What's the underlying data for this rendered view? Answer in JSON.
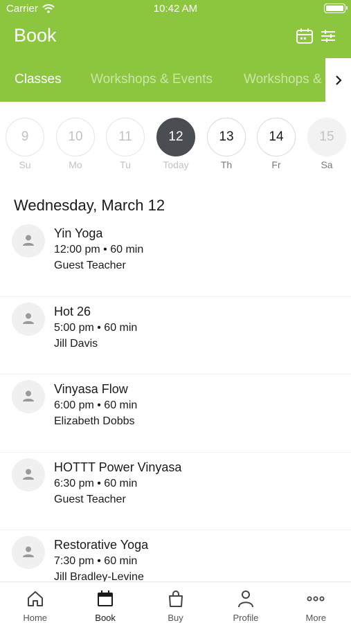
{
  "status_bar": {
    "carrier": "Carrier",
    "time": "10:42 AM"
  },
  "header": {
    "title": "Book",
    "background": "#8cc63f"
  },
  "tabs": [
    {
      "label": "Classes",
      "active": true
    },
    {
      "label": "Workshops & Events",
      "active": false
    },
    {
      "label": "Workshops &",
      "active": false
    }
  ],
  "days": [
    {
      "number": "9",
      "label": "Su"
    },
    {
      "number": "10",
      "label": "Mo"
    },
    {
      "number": "11",
      "label": "Tu"
    },
    {
      "number": "12",
      "label": "Today"
    },
    {
      "number": "13",
      "label": "Th"
    },
    {
      "number": "14",
      "label": "Fr"
    },
    {
      "number": "15",
      "label": "Sa"
    }
  ],
  "date_heading": "Wednesday, March 12",
  "classes": [
    {
      "name": "Yin Yoga",
      "time": "12:00 pm • 60 min",
      "teacher": "Guest Teacher"
    },
    {
      "name": "Hot 26",
      "time": "5:00 pm • 60 min",
      "teacher": "Jill Davis"
    },
    {
      "name": "Vinyasa Flow",
      "time": "6:00 pm • 60 min",
      "teacher": "Elizabeth Dobbs"
    },
    {
      "name": "HOTTT Power Vinyasa",
      "time": "6:30 pm • 60 min",
      "teacher": "Guest Teacher"
    },
    {
      "name": "Restorative Yoga",
      "time": "7:30 pm • 60 min",
      "teacher": "Jill Bradley-Levine"
    }
  ],
  "nav": [
    {
      "label": "Home",
      "icon": "home-icon"
    },
    {
      "label": "Book",
      "icon": "calendar-icon",
      "active": true
    },
    {
      "label": "Buy",
      "icon": "shopping-bag-icon"
    },
    {
      "label": "Profile",
      "icon": "person-icon"
    },
    {
      "label": "More",
      "icon": "more-dots-icon"
    }
  ]
}
